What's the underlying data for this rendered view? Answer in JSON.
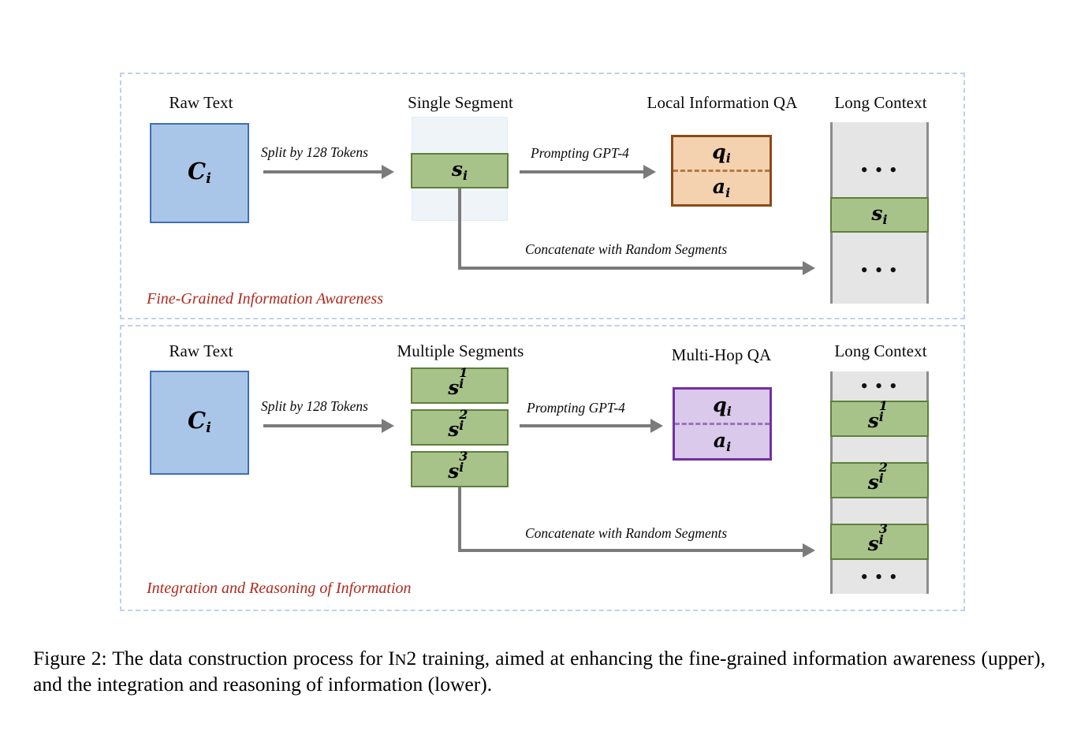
{
  "figure": {
    "caption_prefix": "Figure 2:",
    "caption_part1": " The data construction process for I",
    "caption_smallcaps": "N",
    "caption_part2": "2 training, aimed at enhancing the fine-grained information awareness (upper), and the integration and reasoning of information (lower)."
  },
  "upper_panel": {
    "caption": "Fine-Grained Information Awareness",
    "columns": {
      "raw_text": "Raw Text",
      "segment": "Single Segment",
      "qa": "Local Information QA",
      "long_context": "Long Context"
    },
    "raw_text_symbol": "C",
    "raw_text_subscript": "i",
    "segment_symbol": "s",
    "segment_subscript": "i",
    "qa_question": "q",
    "qa_question_sub": "i",
    "qa_answer": "a",
    "qa_answer_sub": "i",
    "arrow_split_label": "Split by 128 Tokens",
    "arrow_prompt_label": "Prompting GPT-4",
    "arrow_concat_label": "Concatenate with Random Segments",
    "long_context_slots": [
      {
        "type": "filler",
        "label": "• • •"
      },
      {
        "type": "segment",
        "symbol": "s",
        "sub": "i",
        "sup": ""
      },
      {
        "type": "filler",
        "label": "• • •"
      }
    ]
  },
  "lower_panel": {
    "caption": "Integration and Reasoning of Information",
    "columns": {
      "raw_text": "Raw Text",
      "segment": "Multiple Segments",
      "qa": "Multi-Hop QA",
      "long_context": "Long Context"
    },
    "raw_text_symbol": "C",
    "raw_text_subscript": "i",
    "segments": [
      {
        "symbol": "s",
        "sup": "1",
        "sub": "i"
      },
      {
        "symbol": "s",
        "sup": "2",
        "sub": "i"
      },
      {
        "symbol": "s",
        "sup": "3",
        "sub": "i"
      }
    ],
    "qa_question": "q",
    "qa_question_sub": "i",
    "qa_answer": "a",
    "qa_answer_sub": "i",
    "arrow_split_label": "Split by 128 Tokens",
    "arrow_prompt_label": "Prompting GPT-4",
    "arrow_concat_label": "Concatenate with Random Segments",
    "long_context_dots_top": "• • •",
    "long_context_dots_bottom": "• • •"
  },
  "colors": {
    "panel_dash": "#c3cfe9",
    "raw_fill": "#a9c6e8",
    "raw_border": "#3f6fb5",
    "green_fill": "#a8c389",
    "green_border": "#5f7f3b",
    "orange_fill": "#f4d2b0",
    "orange_border": "#8d4a18",
    "purple_fill": "#dac9ea",
    "purple_border": "#7231a1",
    "gray_fill": "#e5e5e5",
    "gray_border": "#8c8c8c",
    "arrow": "#7b7b7b",
    "caption_red": "#b02a1c"
  }
}
